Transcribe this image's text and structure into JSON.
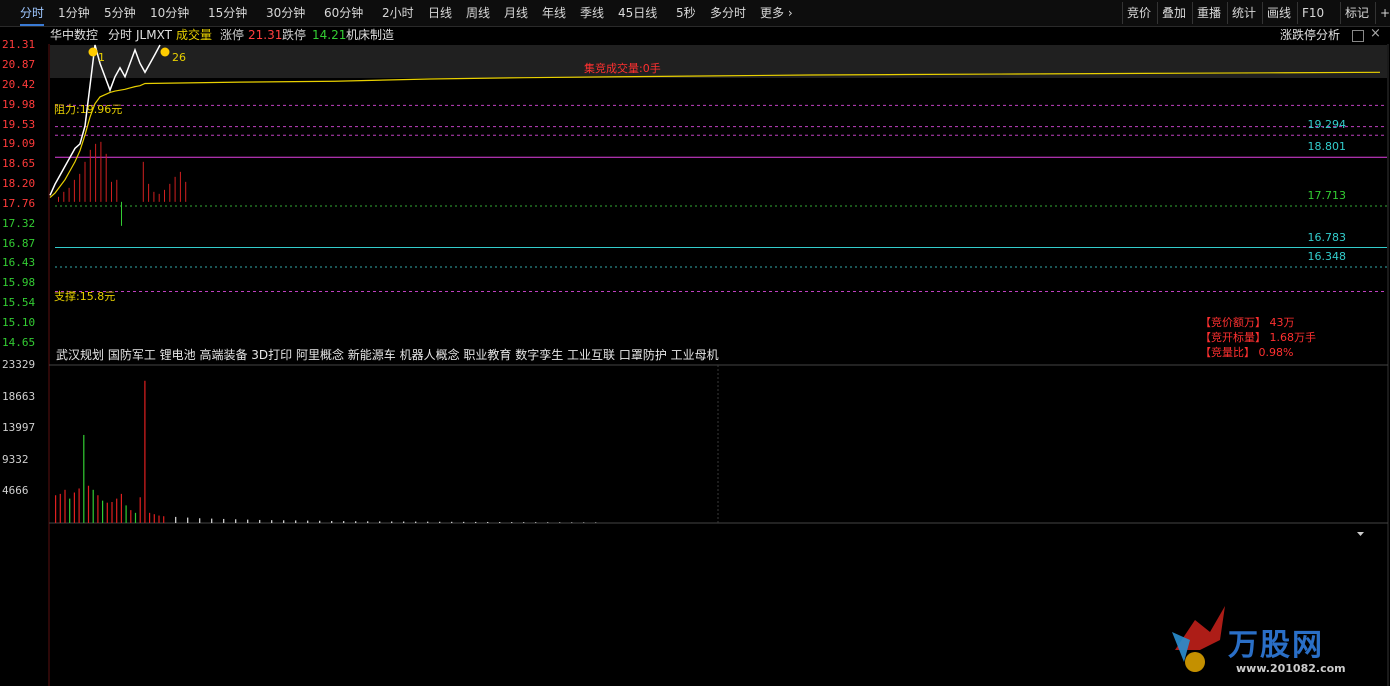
{
  "toolbar": {
    "tabs": [
      "分时",
      "1分钟",
      "5分钟",
      "10分钟",
      "15分钟",
      "30分钟",
      "60分钟",
      "2小时",
      "日线",
      "周线",
      "月线",
      "年线",
      "季线",
      "45日线",
      "5秒",
      "多分时",
      "更多"
    ],
    "right_buttons": [
      "竞价",
      "叠加",
      "重播",
      "统计",
      "画线",
      "F10",
      "标记",
      "+自选"
    ]
  },
  "header": {
    "stock_name": "华中数控",
    "mode": "分时",
    "code": "JLMXT",
    "volume_label": "成交量",
    "limit_up_label": "涨停",
    "limit_up": "21.31",
    "limit_down_label": "跌停",
    "limit_down": "14.21",
    "industry": "机床制造",
    "right_link": "涨跌停分析"
  },
  "price_axis": [
    "21.31",
    "20.87",
    "20.42",
    "19.98",
    "19.53",
    "19.09",
    "18.65",
    "18.20",
    "17.76",
    "17.32",
    "16.87",
    "16.43",
    "15.98",
    "15.54",
    "15.10",
    "14.65"
  ],
  "volume_axis": [
    "23329",
    "18663",
    "13997",
    "9332",
    "4666"
  ],
  "annotations": {
    "resistance": "阻力:19.96元",
    "support": "支撑:15.8元",
    "auction_volume": "集竞成交量:0手",
    "marker_1": "1",
    "marker_2": "26"
  },
  "level_values": [
    "19.294",
    "18.801",
    "17.713",
    "16.783",
    "16.348"
  ],
  "concepts": "武汉规划 国防军工 锂电池 高端装备 3D打印 阿里概念 新能源车 机器人概念 职业教育 数字孪生 工业互联 口罩防护 工业母机",
  "auction_stats": [
    {
      "label": "【竞价额万】",
      "value": "43万"
    },
    {
      "label": "【竞开标量】",
      "value": "1.68万手"
    },
    {
      "label": "【竞量比】",
      "value": "0.98%"
    }
  ],
  "watermark": {
    "brand": "万股网",
    "url": "www.201082.com"
  },
  "colors": {
    "up": "#ff3b3b",
    "down": "#33cc33",
    "avg_line": "#e8d000",
    "price_line": "#ffffff",
    "accent": "#3a7bd5"
  },
  "chart_data": {
    "type": "line",
    "title": "华中数控 分时",
    "ylim": [
      14.65,
      21.31
    ],
    "price_series": [
      17.95,
      18.2,
      18.4,
      18.6,
      18.8,
      19.0,
      19.1,
      19.5,
      20.4,
      21.31,
      20.9,
      20.6,
      20.3,
      20.6,
      20.8,
      20.6,
      20.9,
      21.2,
      20.9,
      20.7,
      20.9,
      21.1,
      21.31
    ],
    "avg_series": [
      17.9,
      18.0,
      18.15,
      18.3,
      18.5,
      18.7,
      18.95,
      19.3,
      19.7,
      20.0,
      20.15,
      20.2,
      20.25,
      20.28,
      20.3,
      20.32,
      20.35,
      20.38,
      20.4,
      20.45,
      20.48,
      20.5,
      20.55,
      20.58,
      20.6,
      20.62,
      20.64,
      20.65,
      20.66,
      20.67,
      20.68,
      20.69,
      20.7
    ],
    "levels": [
      19.96,
      19.294,
      18.801,
      17.713,
      16.783,
      16.348,
      15.8
    ],
    "volume_ylim": [
      0,
      23329
    ],
    "volume": [
      4100,
      4300,
      4900,
      3600,
      4500,
      5100,
      13000,
      5500,
      4900,
      4100,
      3300,
      3000,
      3100,
      3600,
      4300,
      2600,
      1900,
      1500,
      3800,
      21000,
      1500,
      1300,
      1100,
      1000,
      900,
      800,
      700,
      650,
      600,
      550,
      500,
      450,
      420,
      400,
      380,
      350,
      330,
      300,
      280,
      260,
      250,
      240,
      230,
      220,
      210,
      200,
      190,
      180,
      170,
      160,
      150,
      140,
      130,
      120,
      110,
      100,
      95,
      90,
      85,
      80
    ]
  }
}
